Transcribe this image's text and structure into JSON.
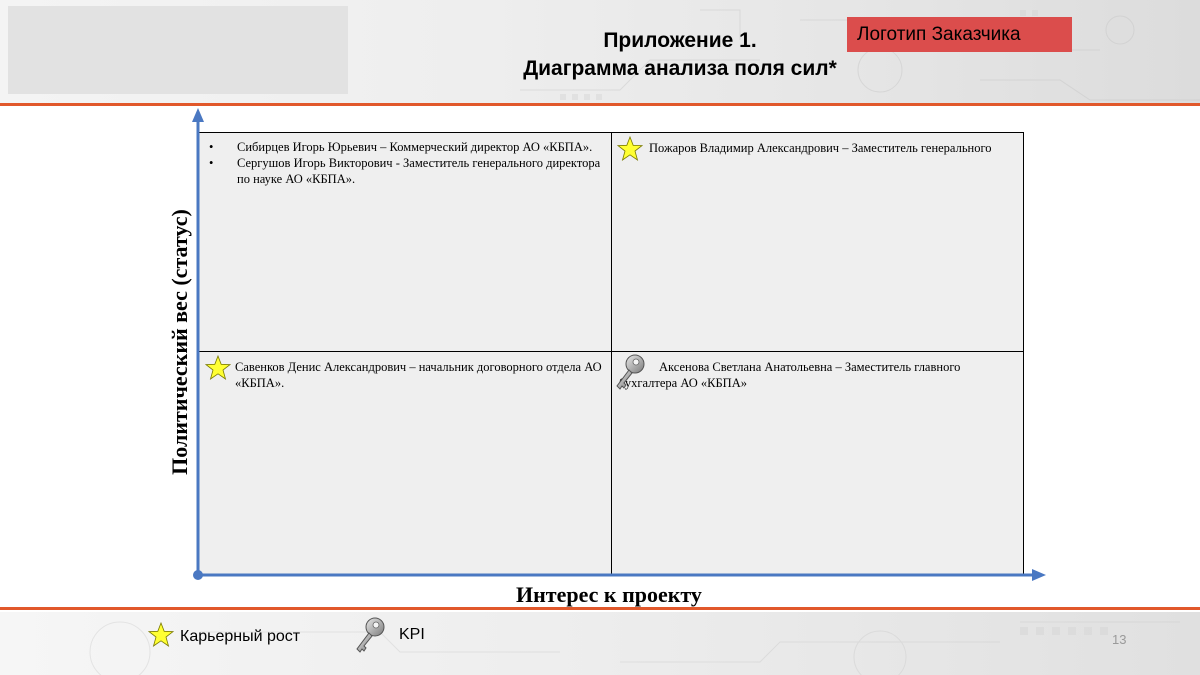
{
  "header": {
    "title_line1": "Приложение 1.",
    "title_line2": "Диаграмма анализа поля сил*",
    "logo_label": "Логотип Заказчика"
  },
  "axes": {
    "y_label": "Политический вес (статус)",
    "x_label": "Интерес к проекту"
  },
  "quadrants": {
    "top_left": {
      "bullet": "•",
      "items": [
        "Сибирцев Игорь Юрьевич – Коммерческий директор АО «КБПА».",
        "Сергушов Игорь Викторович - Заместитель генерального директора по науке АО «КБПА»."
      ]
    },
    "top_right": {
      "icon": "star-icon",
      "text": "Пожаров Владимир Александрович – Заместитель генерального"
    },
    "bottom_left": {
      "icon": "star-icon",
      "text": "Савенков Денис Александрович – начальник договорного отдела АО «КБПА»."
    },
    "bottom_right": {
      "icon": "key-icon",
      "text": "Аксенова Светлана Анатольевна – Заместитель главного бухгалтера АО «КБПА»"
    }
  },
  "legend": {
    "career_label": "Карьерный рост",
    "kpi_label": "KPI"
  },
  "page_number": "13",
  "colors": {
    "accent_line": "#e1582b",
    "axis_blue": "#4a78c2",
    "logo_box": "#db4d4c",
    "star_fill": "#ffff33"
  }
}
